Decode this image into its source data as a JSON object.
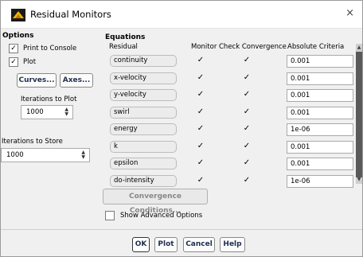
{
  "window": {
    "title": "Residual Monitors",
    "close_glyph": "×"
  },
  "options": {
    "title": "Options",
    "print_to_console": {
      "label": "Print to Console",
      "checked": true
    },
    "plot": {
      "label": "Plot",
      "checked": true
    },
    "curves_label": "Curves...",
    "axes_label": "Axes...",
    "iterations_to_plot_label": "Iterations to Plot",
    "iterations_to_plot_value": "1000",
    "iterations_to_store_label": "Iterations to Store",
    "iterations_to_store_value": "1000"
  },
  "equations": {
    "title": "Equations",
    "headers": {
      "residual": "Residual",
      "monitor": "Monitor",
      "check": "Check Convergence",
      "criteria": "Absolute Criteria"
    },
    "rows": [
      {
        "residual": "continuity",
        "monitor": true,
        "check": true,
        "criteria": "0.001"
      },
      {
        "residual": "x-velocity",
        "monitor": true,
        "check": true,
        "criteria": "0.001"
      },
      {
        "residual": "y-velocity",
        "monitor": true,
        "check": true,
        "criteria": "0.001"
      },
      {
        "residual": "swirl",
        "monitor": true,
        "check": true,
        "criteria": "0.001"
      },
      {
        "residual": "energy",
        "monitor": true,
        "check": true,
        "criteria": "1e-06"
      },
      {
        "residual": "k",
        "monitor": true,
        "check": true,
        "criteria": "0.001"
      },
      {
        "residual": "epsilon",
        "monitor": true,
        "check": true,
        "criteria": "0.001"
      },
      {
        "residual": "do-intensity",
        "monitor": true,
        "check": true,
        "criteria": "1e-06"
      }
    ],
    "convergence_conditions_label": "Convergence Conditions...",
    "show_advanced_label": "Show Advanced Options",
    "show_advanced_checked": false
  },
  "footer": {
    "ok": "OK",
    "plot": "Plot",
    "cancel": "Cancel",
    "help": "Help"
  }
}
